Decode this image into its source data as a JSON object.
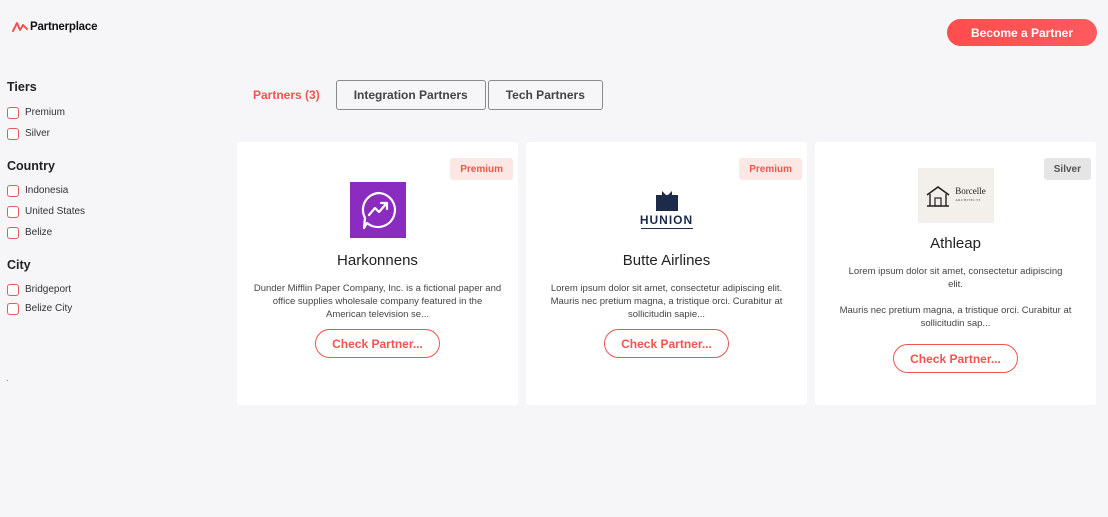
{
  "header": {
    "logo_text": "Partnerplace",
    "cta_label": "Become a Partner"
  },
  "sidebar": {
    "groups": [
      {
        "title": "Tiers",
        "options": [
          "Premium",
          "Silver"
        ]
      },
      {
        "title": "Country",
        "options": [
          "Indonesia",
          "United States",
          "Belize"
        ]
      },
      {
        "title": "City",
        "options": [
          "Bridgeport",
          "Belize City"
        ]
      }
    ],
    "footer_mark": "."
  },
  "tabs": {
    "active": "Partners (3)",
    "items": [
      "Integration Partners",
      "Tech Partners"
    ]
  },
  "cards": [
    {
      "badge": "Premium",
      "name": "Harkonnens",
      "description": "Dunder Mifflin Paper Company, Inc. is a fictional paper and office supplies wholesale company featured in the American television se...",
      "button": "Check Partner..."
    },
    {
      "badge": "Premium",
      "name": "Butte Airlines",
      "logo_text": "HUNION",
      "description": "Lorem ipsum dolor sit amet, consectetur adipiscing elit. Mauris nec pretium magna, a tristique orci. Curabitur at sollicitudin sapie...",
      "button": "Check Partner..."
    },
    {
      "badge": "Silver",
      "name": "Athleap",
      "logo_text": "Borcelle",
      "logo_sub": "ARCHITECTS",
      "description": "Lorem ipsum dolor sit amet, consectetur adipiscing elit.",
      "description_2": "Mauris nec pretium magna, a tristique orci. Curabitur at sollicitudin sap...",
      "button": "Check Partner..."
    }
  ],
  "colors": {
    "accent": "#f2544f",
    "background": "#f6f5f8",
    "purple_logo": "#8a2cbf",
    "navy_logo": "#1c2b4a"
  }
}
